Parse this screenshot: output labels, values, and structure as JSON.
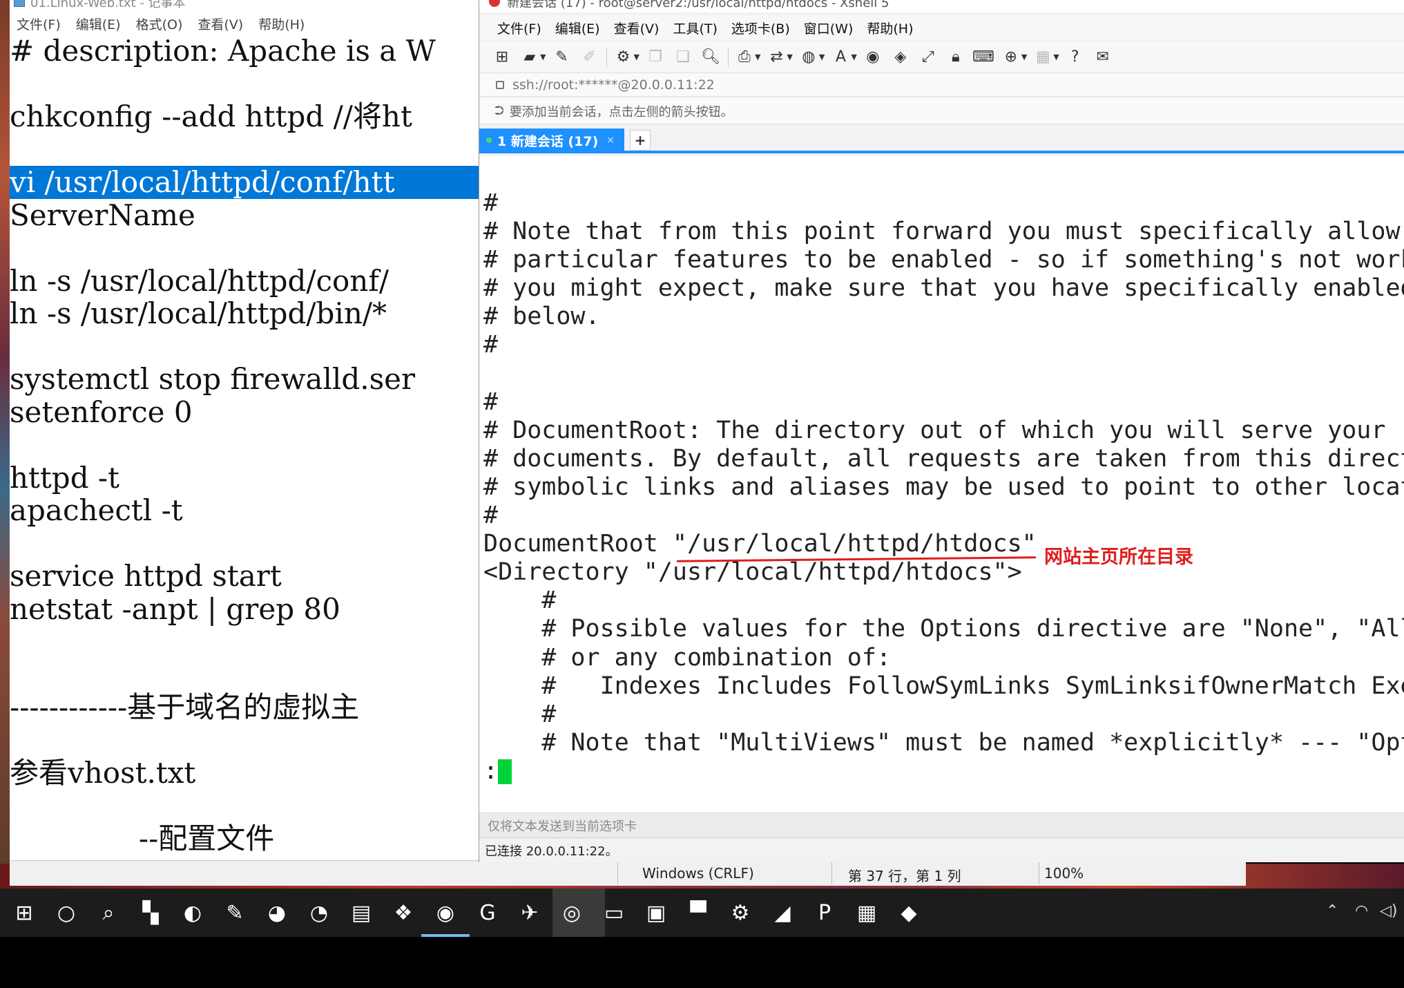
{
  "notepad": {
    "title": "01.Linux-Web.txt - 记事本",
    "menu": [
      "文件(F)",
      "编辑(E)",
      "格式(O)",
      "查看(V)",
      "帮助(H)"
    ],
    "lines": [
      "# description: Apache is a W",
      "",
      "chkconfig --add httpd //将ht",
      "",
      "vi /usr/local/httpd/conf/htt",
      "ServerName",
      "",
      "ln -s /usr/local/httpd/conf/",
      "ln -s /usr/local/httpd/bin/*",
      "",
      "systemctl stop firewalld.ser",
      "setenforce 0",
      "",
      "httpd -t",
      "apachectl -t",
      "",
      "service httpd start",
      "netstat -anpt | grep 80",
      "",
      "",
      "------------基于域名的虚拟主",
      "",
      "参看vhost.txt",
      "",
      "              --配置文件"
    ],
    "highlight_index": 4,
    "status": {
      "encoding": "Windows (CRLF)",
      "position": "第 37 行，第 1 列",
      "zoom": "100%"
    }
  },
  "xshell": {
    "title": "新建会话 (17) - root@server2:/usr/local/httpd/htdocs - Xshell 5",
    "menu": [
      "文件(F)",
      "编辑(E)",
      "查看(V)",
      "工具(T)",
      "选项卡(B)",
      "窗口(W)",
      "帮助(H)"
    ],
    "address": "ssh://root:******@20.0.0.11:22",
    "hint": "要添加当前会话，点击左侧的箭头按钮。",
    "tab_label": "1 新建会话 (17)",
    "tab_close": "×",
    "tab_add": "+",
    "terminal_lines": [
      "#",
      "# Note that from this point forward you must specifically allow",
      "# particular features to be enabled - so if something's not worki",
      "# you might expect, make sure that you have specifically enabled",
      "# below.",
      "#",
      "",
      "#",
      "# DocumentRoot: The directory out of which you will serve your",
      "# documents. By default, all requests are taken from this directo",
      "# symbolic links and aliases may be used to point to other locati",
      "#",
      "DocumentRoot \"/usr/local/httpd/htdocs\"",
      "<Directory \"/usr/local/httpd/htdocs\">",
      "    #",
      "    # Possible values for the Options directive are \"None\", \"All\"",
      "    # or any combination of:",
      "    #   Indexes Includes FollowSymLinks SymLinksifOwnerMatch Exec",
      "    #",
      "    # Note that \"MultiViews\" must be named *explicitly* --- \"Opti"
    ],
    "prompt": ":",
    "annotation": "网站主页所在目录",
    "send_bar": "仅将文本发送到当前选项卡",
    "status": "已连接 20.0.0.11:22。",
    "colors": {
      "tab": "#1e90ff",
      "cursor": "#00d23a",
      "annotation": "#e01d1d"
    }
  },
  "taskbar": {
    "icons": [
      "windows-start-icon",
      "cortana-icon",
      "search-icon",
      "app-icon",
      "browser-icon",
      "notes-icon",
      "media-icon",
      "paint-icon",
      "files-icon",
      "network-icon",
      "xshell-icon",
      "xftp-icon",
      "mail-icon",
      "wechat-icon",
      "explorer-icon",
      "store-icon",
      "monitor-icon",
      "settings-icon",
      "pen-icon",
      "powerpoint-icon",
      "remote-icon",
      "nvidia-icon"
    ]
  }
}
